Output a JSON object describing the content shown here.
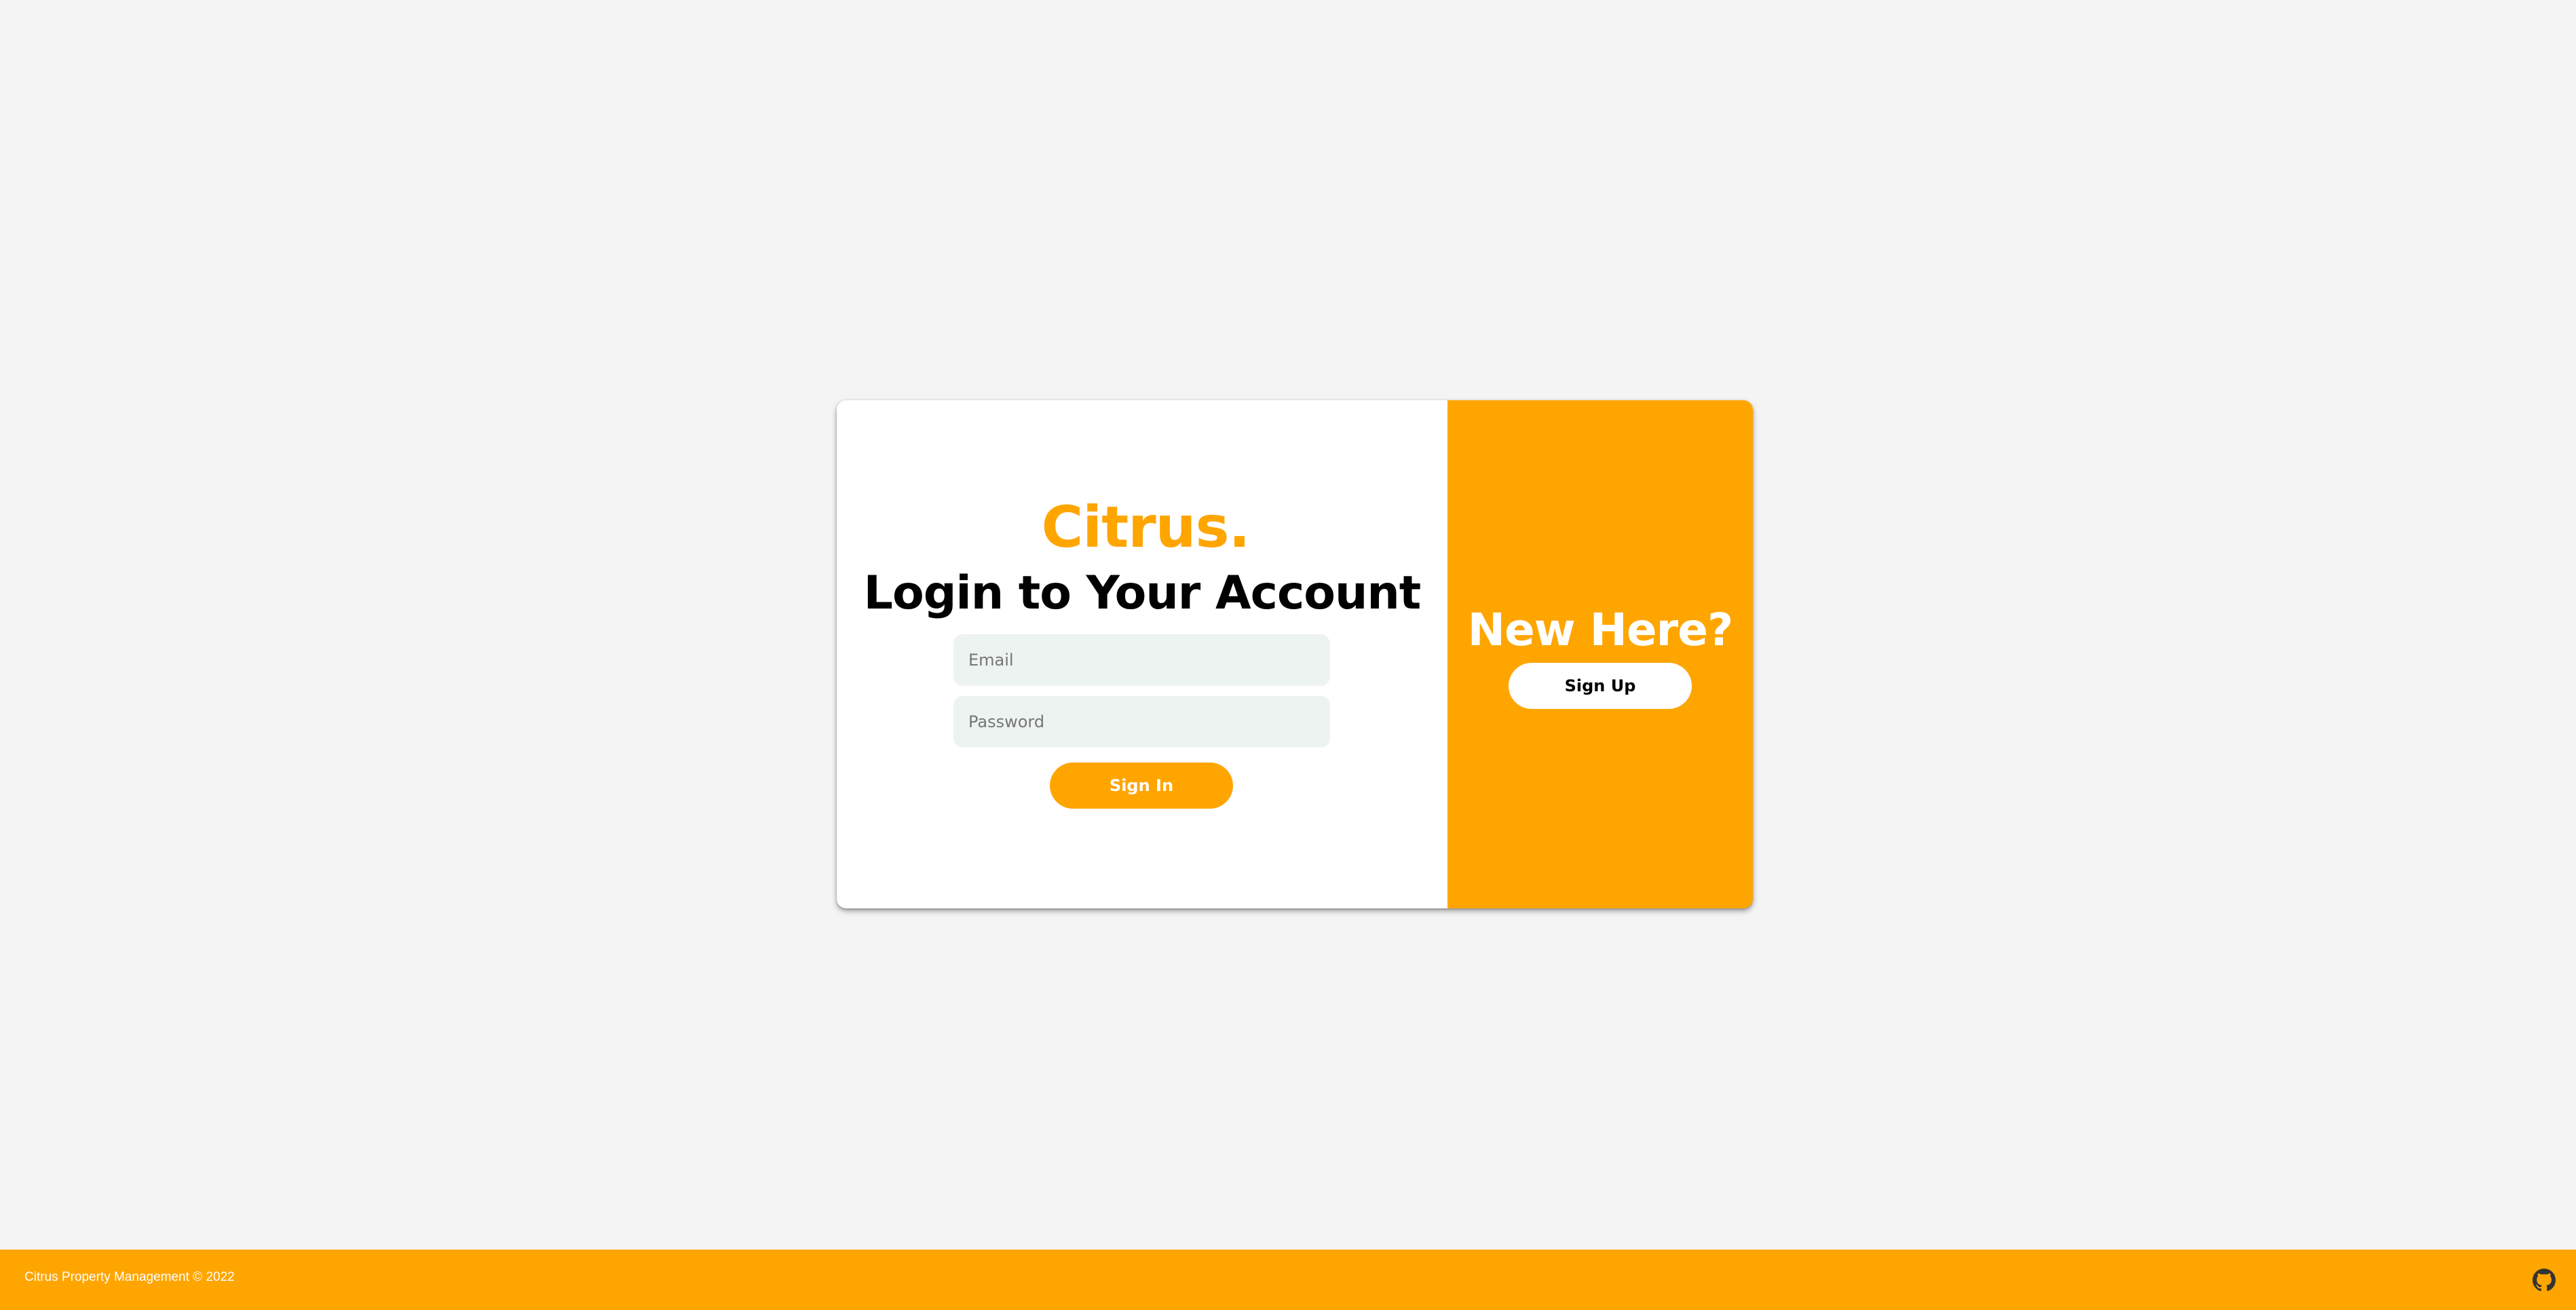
{
  "colors": {
    "accent": "#ffa500",
    "background": "#f4f4f4",
    "input_bg": "#ecf3f1"
  },
  "login": {
    "brand": "Citrus.",
    "title": "Login to Your Account",
    "email_placeholder": "Email",
    "password_placeholder": "Password",
    "signin_label": "Sign In"
  },
  "signup": {
    "heading": "New Here?",
    "signup_label": "Sign Up"
  },
  "footer": {
    "copyright": "Citrus Property Management © 2022",
    "github_icon": "github-icon"
  }
}
